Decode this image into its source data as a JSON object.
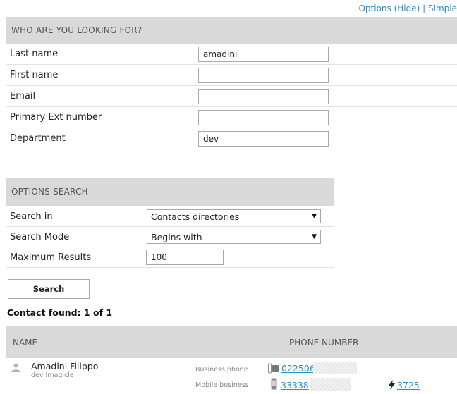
{
  "top_links": {
    "options": "Options (Hide)",
    "separator": "|",
    "simple": "Simple"
  },
  "who": {
    "header": "WHO ARE YOU LOOKING FOR?",
    "fields": [
      {
        "label": "Last name",
        "value": "amadini"
      },
      {
        "label": "First name",
        "value": ""
      },
      {
        "label": "Email",
        "value": ""
      },
      {
        "label": "Primary Ext number",
        "value": ""
      },
      {
        "label": "Department",
        "value": "dev"
      }
    ]
  },
  "options": {
    "header": "OPTIONS SEARCH",
    "search_in": {
      "label": "Search in",
      "value": "Contacts directories"
    },
    "search_mode": {
      "label": "Search Mode",
      "value": "Begins with"
    },
    "max_results": {
      "label": "Maximum Results",
      "value": "100"
    }
  },
  "search_button": "Search",
  "found_text": "Contact found: 1 of 1",
  "results": {
    "columns": {
      "name": "NAME",
      "phone": "PHONE NUMBER"
    },
    "contact": {
      "name": "Amadini Filippo",
      "sub": "dev Imagicle",
      "business_label": "Business phone",
      "business_number": "022506",
      "mobile_label": "Mobile business",
      "mobile_number": "33338",
      "extension": "3725"
    }
  }
}
